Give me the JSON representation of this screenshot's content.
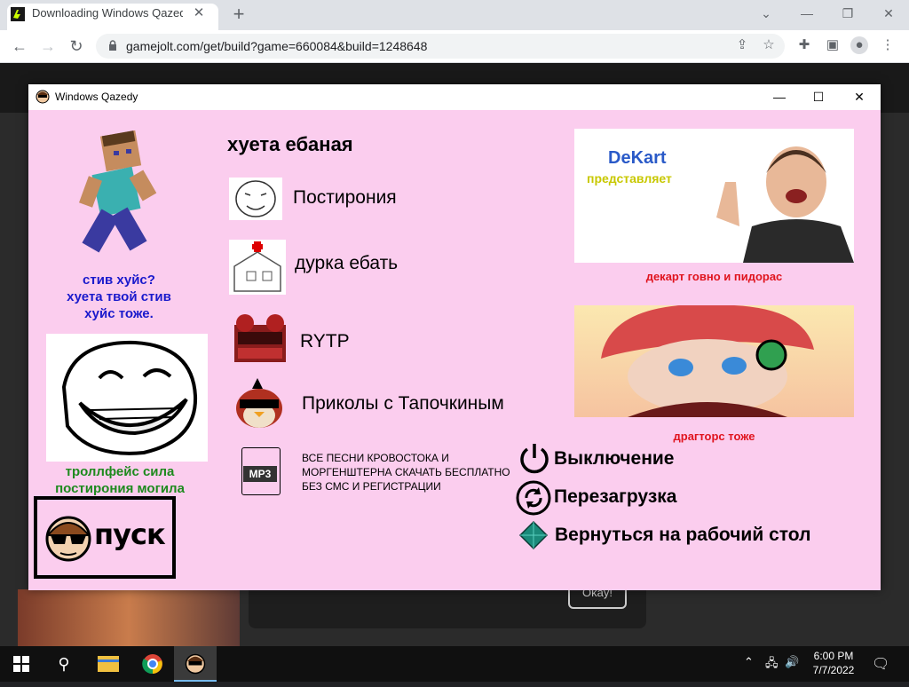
{
  "browser": {
    "tab_title": "Downloading Windows Qazedy - ...",
    "tab_close": "✕",
    "new_tab": "+",
    "url": "gamejolt.com/get/build?game=660084&build=1248648"
  },
  "background": {
    "okay_button": "Okay!"
  },
  "app": {
    "title": "Windows Qazedy",
    "heading": "хуета ебаная",
    "menu": [
      {
        "label": "Постирония"
      },
      {
        "label": "дурка ебать"
      },
      {
        "label": "RYTP"
      },
      {
        "label": "Приколы с Тапочкиным"
      }
    ],
    "mp3_label": "MP3",
    "mp3_text": "ВСЕ ПЕСНИ КРОВОСТОКА И МОРГЕНШТЕРНА СКАЧАТЬ БЕСПЛАТНО БЕЗ СМС И РЕГИСТРАЦИИ",
    "steve_caption": "стив хуйс?\nхуета твой стив\nхуйс тоже.",
    "troll_caption": "троллфейс сила\nпостирония могила",
    "start_label": "пуск",
    "dekart_caption": "декарт говно и пидорас",
    "dekart_banner_1": "DeKart",
    "dekart_banner_2": "представляет",
    "dragtors_caption": "драгторс тоже",
    "power_menu": [
      {
        "label": "Выключение"
      },
      {
        "label": "Перезагрузка"
      },
      {
        "label": "Вернуться на рабочий стол"
      }
    ],
    "colors": {
      "background": "#fbcdee",
      "steve_caption": "#1a1acc",
      "troll_caption": "#1e8a1e",
      "red_caption": "#e0141e"
    }
  },
  "taskbar": {
    "time": "6:00 PM",
    "date": "7/7/2022"
  }
}
